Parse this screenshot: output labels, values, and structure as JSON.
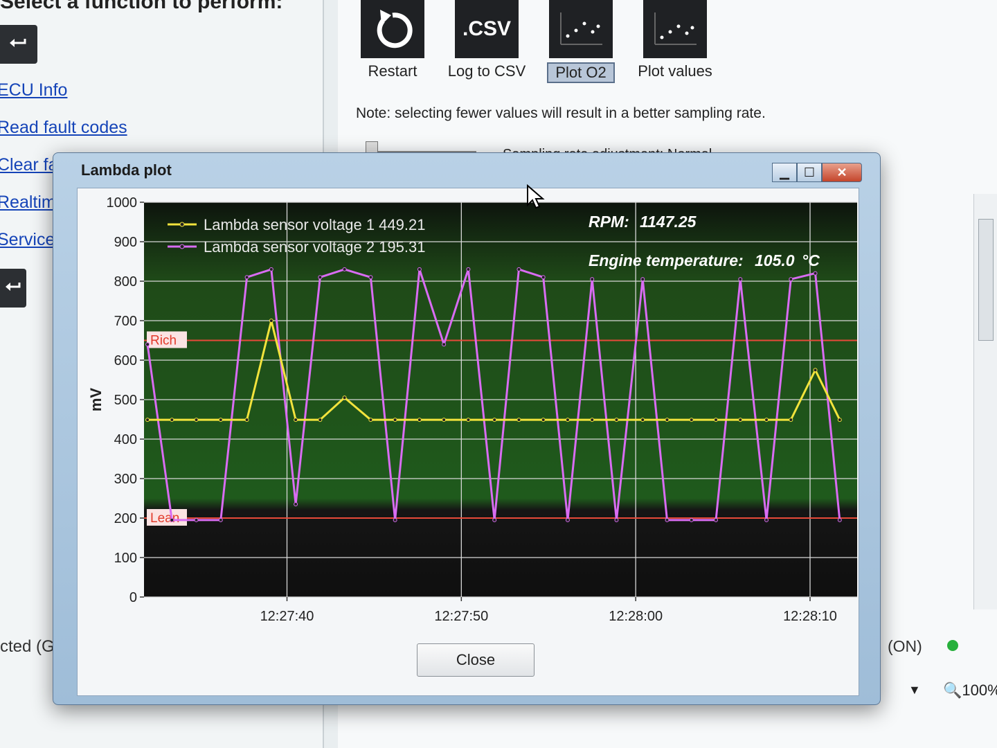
{
  "background_app": {
    "heading": "Select a function to perform:",
    "left_links": [
      "ECU Info",
      "Read fault codes",
      "Clear fault",
      "Realtime",
      "Service fu"
    ],
    "toolbar": [
      {
        "label": "Restart",
        "icon": "restart-icon",
        "tile_text": ""
      },
      {
        "label": "Log to CSV",
        "icon": "csv-icon",
        "tile_text": ".CSV"
      },
      {
        "label": "Plot O2",
        "icon": "plot-icon",
        "tile_text": "",
        "active": true
      },
      {
        "label": "Plot values",
        "icon": "plot-icon",
        "tile_text": ""
      }
    ],
    "note": "Note: selecting fewer values will result in a better sampling rate.",
    "sampling_label": "Sampling rate adjustment: Normal",
    "status_left": "cted (G",
    "status_right": "(ON)",
    "zoom": "100%"
  },
  "dialog": {
    "title": "Lambda plot",
    "close_label": "Close",
    "rpm_label": "RPM:",
    "rpm_value": "1147.25",
    "temp_label": "Engine temperature:",
    "temp_value": "105.0",
    "temp_unit": "°C"
  },
  "chart_data": {
    "type": "line",
    "ylabel": "mV",
    "ylim": [
      0,
      1000
    ],
    "yticks": [
      0,
      100,
      200,
      300,
      400,
      500,
      600,
      700,
      800,
      900,
      1000
    ],
    "xticks": [
      "12:27:40",
      "12:27:50",
      "12:28:00",
      "12:28:10"
    ],
    "xtick_seconds": [
      40,
      50,
      60,
      70
    ],
    "xlim_seconds": [
      31.8,
      72.7
    ],
    "x_seconds": [
      32.0,
      33.4,
      34.8,
      36.2,
      37.7,
      39.1,
      40.5,
      41.9,
      43.3,
      44.8,
      46.2,
      47.6,
      49.0,
      50.4,
      51.9,
      53.3,
      54.7,
      56.1,
      57.5,
      58.9,
      60.4,
      61.8,
      63.2,
      64.6,
      66.0,
      67.5,
      68.9,
      70.3,
      71.7
    ],
    "series": [
      {
        "name": "Lambda sensor voltage 1",
        "current": "449.21",
        "color": "#f2e33c",
        "values": [
          449,
          449,
          449,
          449,
          449,
          700,
          449,
          449,
          505,
          449,
          449,
          449,
          449,
          449,
          449,
          449,
          449,
          449,
          449,
          449,
          449,
          449,
          449,
          449,
          449,
          449,
          449,
          575,
          449
        ]
      },
      {
        "name": "Lambda sensor voltage 2",
        "current": "195.31",
        "color": "#d86cf2",
        "values": [
          640,
          195,
          195,
          195,
          810,
          830,
          235,
          810,
          830,
          810,
          195,
          830,
          640,
          830,
          195,
          830,
          810,
          195,
          805,
          195,
          805,
          195,
          195,
          195,
          805,
          195,
          805,
          820,
          195
        ]
      }
    ],
    "thresholds": [
      {
        "label": "Rich",
        "value": 650,
        "color": "#e84a3a"
      },
      {
        "label": "Lean",
        "value": 200,
        "color": "#e84a3a"
      }
    ],
    "grid": true,
    "legend_position": "top-left"
  }
}
